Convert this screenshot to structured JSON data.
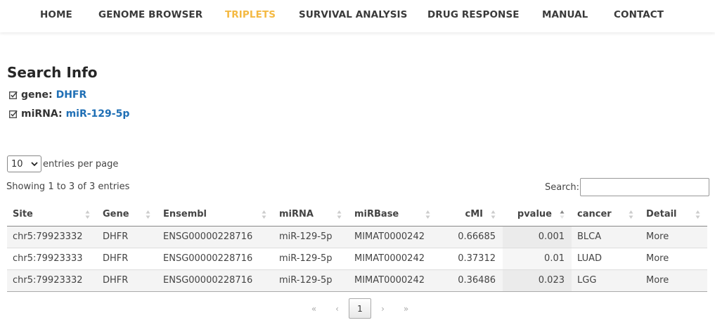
{
  "nav": {
    "items": [
      {
        "label": "HOME"
      },
      {
        "label": "GENOME BROWSER"
      },
      {
        "label": "TRIPLETS"
      },
      {
        "label": "SURVIVAL ANALYSIS"
      },
      {
        "label": "DRUG RESPONSE"
      },
      {
        "label": "MANUAL"
      },
      {
        "label": "CONTACT"
      }
    ],
    "active": "TRIPLETS",
    "active_color": "#f4b942"
  },
  "search_info": {
    "title": "Search Info",
    "gene_label": "gene:",
    "gene_value": "DHFR",
    "mirna_label": "miRNA:",
    "mirna_value": "miR-129-5p",
    "link_color": "#1f6fb5"
  },
  "table_controls": {
    "length_value": "10",
    "length_label": "entries per page",
    "showing": "Showing 1 to 3 of 3 entries",
    "search_label": "Search:",
    "search_value": ""
  },
  "table": {
    "columns": [
      "Site",
      "Gene",
      "Ensembl",
      "miRNA",
      "miRBase",
      "cMI",
      "pvalue",
      "cancer",
      "Detail"
    ],
    "sorted_column": "pvalue",
    "rows": [
      [
        "chr5:79923332",
        "DHFR",
        "ENSG00000228716",
        "miR-129-5p",
        "MIMAT0000242",
        "0.66685",
        "0.001",
        "BLCA",
        "More"
      ],
      [
        "chr5:79923333",
        "DHFR",
        "ENSG00000228716",
        "miR-129-5p",
        "MIMAT0000242",
        "0.37312",
        "0.01",
        "LUAD",
        "More"
      ],
      [
        "chr5:79923332",
        "DHFR",
        "ENSG00000228716",
        "miR-129-5p",
        "MIMAT0000242",
        "0.36486",
        "0.023",
        "LGG",
        "More"
      ]
    ]
  },
  "pagination": {
    "first": "«",
    "prev": "‹",
    "current": "1",
    "next": "›",
    "last": "»"
  }
}
